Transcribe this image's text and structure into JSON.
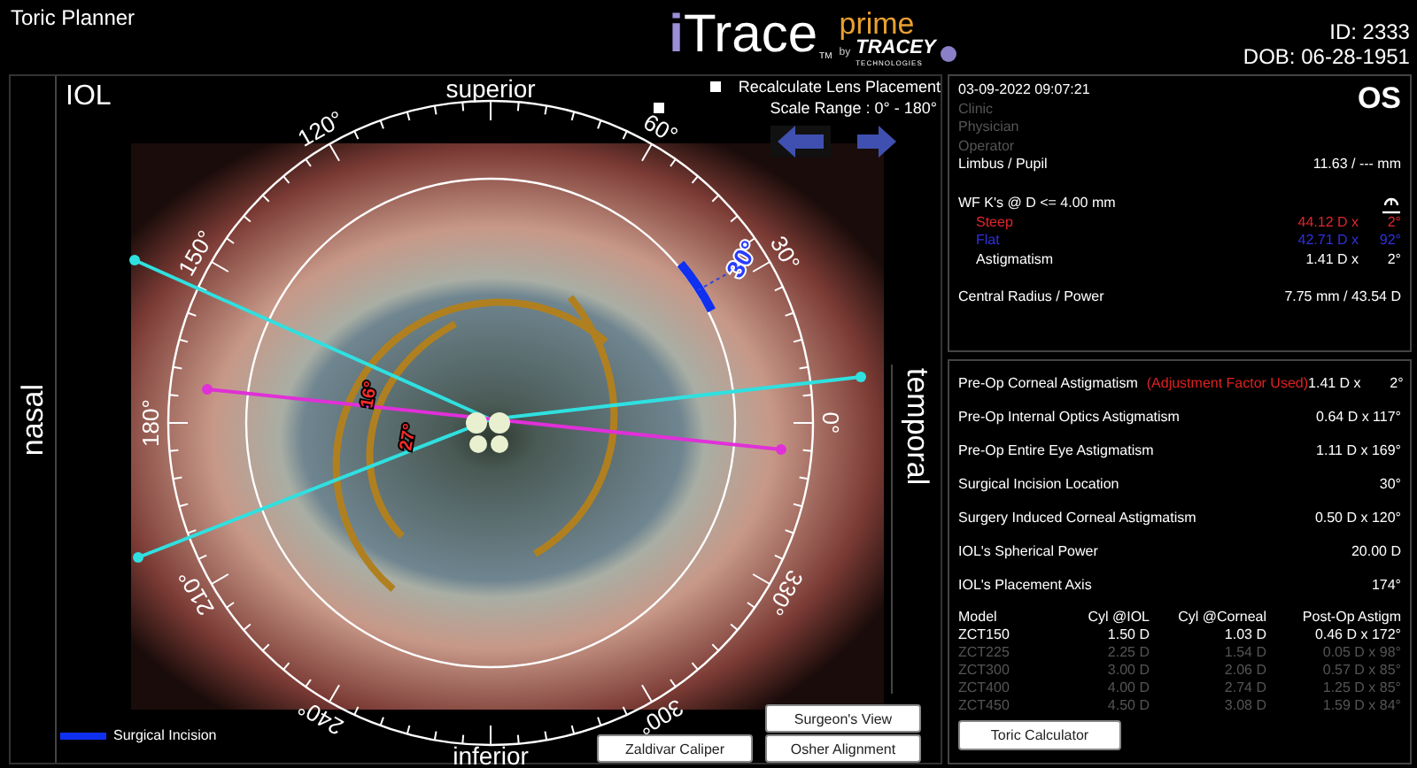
{
  "header": {
    "title": "Toric Planner",
    "logo": {
      "brand_initial": "i",
      "brand": "Trace",
      "trademark": "TM",
      "edition": "prime",
      "by": "by",
      "company": "TRACEY",
      "company_tagline": "TECHNOLOGIES"
    },
    "patient_id": "ID: 2333",
    "dob": "DOB: 06-28-1951"
  },
  "viewer": {
    "label": "IOL",
    "superior": "superior",
    "inferior": "inferior",
    "nasal": "nasal",
    "temporal": "temporal",
    "options": [
      {
        "label": "Recalculate Lens Placement",
        "checked": false
      },
      {
        "label": "Scale Range : 0° - 180°",
        "checked": false
      }
    ],
    "scale_labels": [
      "0°",
      "30°",
      "60°",
      "120°",
      "150°",
      "180°",
      "210°",
      "240°",
      "300°",
      "330°"
    ],
    "axis_labels": [
      "16°",
      "27°"
    ],
    "incision_label": "30°",
    "legend": "Surgical Incision",
    "buttons": [
      "Surgeon's View",
      "Zaldivar Caliper",
      "Osher Alignment"
    ]
  },
  "exam": {
    "datetime": "03-09-2022 09:07:21",
    "eye": "OS",
    "meta": [
      "Clinic",
      "Physician",
      "Operator"
    ],
    "limbus": {
      "label": "Limbus / Pupil",
      "value": "11.63 / --- mm"
    },
    "wf": {
      "title": "WF K's @ D <= 4.00 mm",
      "rows": [
        {
          "label": "Steep",
          "value": "44.12 D x",
          "axis": "2°",
          "color": "#e0262b"
        },
        {
          "label": "Flat",
          "value": "42.71 D x",
          "axis": "92°",
          "color": "#3030e0"
        },
        {
          "label": "Astigmatism",
          "value": "1.41 D x",
          "axis": "2°",
          "color": "#ffffff"
        }
      ]
    },
    "central": {
      "label": "Central Radius / Power",
      "value": "7.75 mm / 43.54 D"
    }
  },
  "plan": {
    "rows": [
      {
        "label": "Pre-Op Corneal Astigmatism",
        "note": "(Adjustment Factor Used)",
        "value": "1.41 D x",
        "axis": "2°"
      },
      {
        "label": "Pre-Op Internal Optics Astigmatism",
        "value": "0.64 D x 117°"
      },
      {
        "label": "Pre-Op Entire Eye Astigmatism",
        "value": "1.11 D x 169°"
      },
      {
        "label": "Surgical Incision Location",
        "value": "30°"
      },
      {
        "label": "Surgery Induced Corneal Astigmatism",
        "value": "0.50 D x 120°"
      },
      {
        "label": "IOL's Spherical Power",
        "value": "20.00 D"
      },
      {
        "label": "IOL's Placement Axis",
        "value": "174°"
      }
    ],
    "lens_table": {
      "columns": [
        "Model",
        "Cyl @IOL",
        "Cyl @Corneal",
        "Post-Op Astigm"
      ],
      "rows": [
        {
          "cells": [
            "ZCT150",
            "1.50 D",
            "1.03 D",
            "0.46 D x 172°"
          ],
          "selected": true
        },
        {
          "cells": [
            "ZCT225",
            "2.25 D",
            "1.54 D",
            "0.05 D x  98°"
          ],
          "selected": false
        },
        {
          "cells": [
            "ZCT300",
            "3.00 D",
            "2.06 D",
            "0.57 D x  85°"
          ],
          "selected": false
        },
        {
          "cells": [
            "ZCT400",
            "4.00 D",
            "2.74 D",
            "1.25 D x  85°"
          ],
          "selected": false
        },
        {
          "cells": [
            "ZCT450",
            "4.50 D",
            "3.08 D",
            "1.59 D x  84°"
          ],
          "selected": false
        }
      ]
    },
    "button": "Toric Calculator"
  }
}
